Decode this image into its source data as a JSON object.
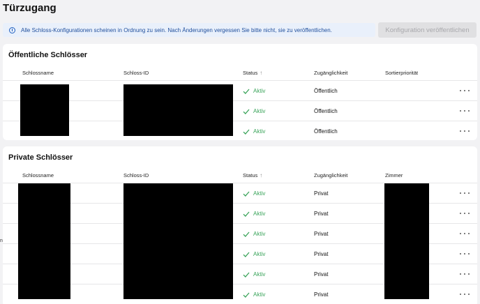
{
  "page": {
    "title": "Türzugang"
  },
  "banner": {
    "icon": "info-icon",
    "text": "Alle Schloss-Konfigurationen scheinen in Ordnung zu sein. Nach Änderungen vergessen Sie bitte nicht, sie zu veröffentlichen.",
    "color": "#e9f0fb"
  },
  "publish_button": {
    "label": "Konfiguration veröffentlichen",
    "disabled": true
  },
  "public_locks": {
    "title": "Öffentliche Schlösser",
    "columns": [
      "Schlossname",
      "Schloss-ID",
      "Status",
      "Zugänglichkeit",
      "Sortierpriorität"
    ],
    "sorted_column_icon": "arrow-up-icon",
    "rows": [
      {
        "status": "Aktiv",
        "access": "Öffentlich"
      },
      {
        "status": "Aktiv",
        "access": "Öffentlich"
      },
      {
        "status": "Aktiv",
        "access": "Öffentlich"
      }
    ]
  },
  "private_locks": {
    "title": "Private Schlösser",
    "columns": [
      "Schlossname",
      "Schloss-ID",
      "Status",
      "Zugänglichkeit",
      "Zimmer"
    ],
    "sorted_column_icon": "arrow-up-icon",
    "rows": [
      {
        "status": "Aktiv",
        "access": "Privat"
      },
      {
        "status": "Aktiv",
        "access": "Privat"
      },
      {
        "status": "Aktiv",
        "access": "Privat"
      },
      {
        "status": "Aktiv",
        "access": "Privat"
      },
      {
        "status": "Aktiv",
        "access": "Privat"
      },
      {
        "status": "Aktiv",
        "access": "Privat"
      }
    ]
  },
  "status_color": "#3aa45a",
  "stray_char": "n"
}
